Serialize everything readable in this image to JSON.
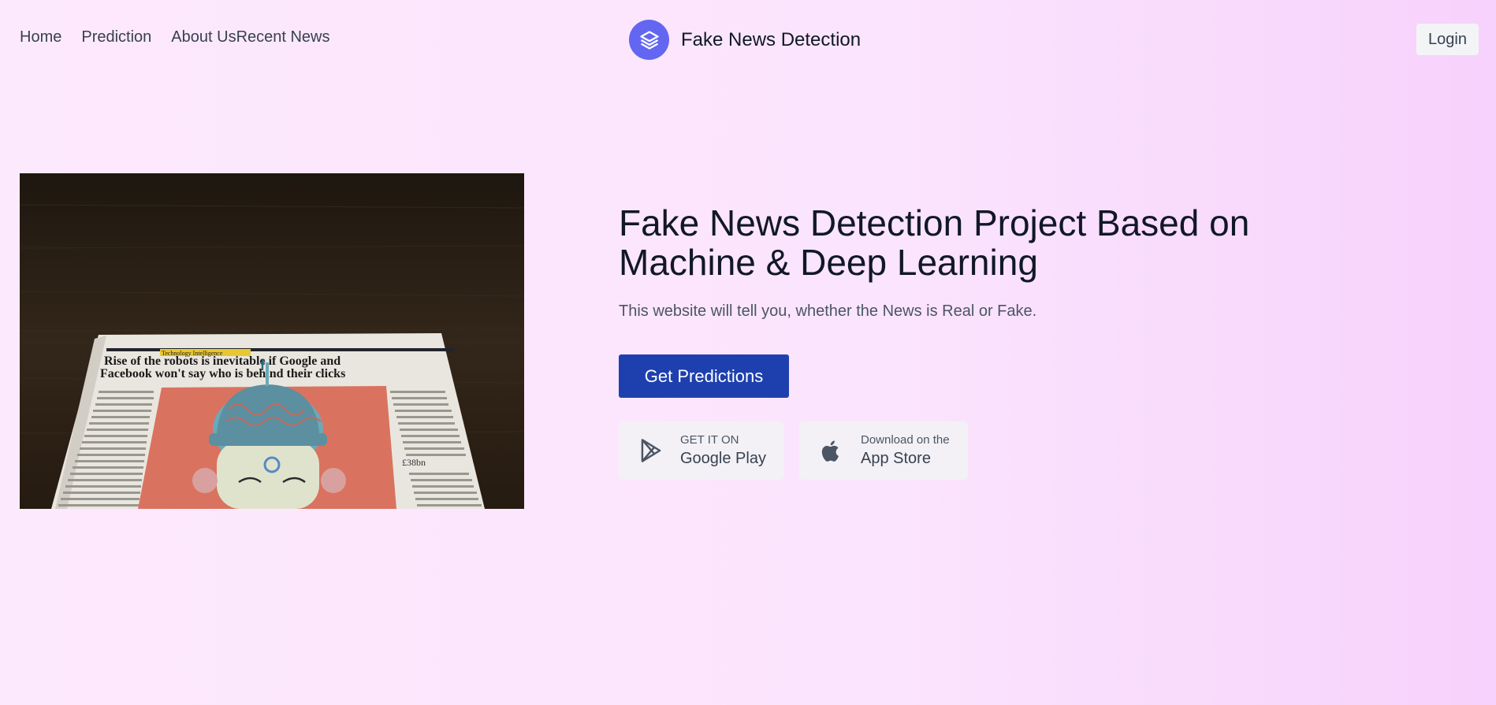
{
  "nav": {
    "home": "Home",
    "prediction": "Prediction",
    "about": "About Us",
    "news": "Recent News"
  },
  "brand": {
    "name": "Fake News Detection",
    "icon": "layers-icon",
    "color": "#6366f1"
  },
  "login_label": "Login",
  "hero": {
    "image_alt": "Newspaper article about robots and Google and Facebook",
    "title": "Fake News Detection Project Based on Machine & Deep Learning",
    "subtitle": "This website will tell you, whether the News is Real or Fake.",
    "cta_label": "Get Predictions",
    "cta_color": "#1e40af"
  },
  "stores": {
    "google": {
      "small": "GET IT ON",
      "big": "Google Play",
      "icon": "google-play-icon"
    },
    "apple": {
      "small": "Download on the",
      "big": "App Store",
      "icon": "apple-icon"
    }
  },
  "newspaper": {
    "section": "Technology Intelligence",
    "headline_1": "Rise of the robots is inevitable if Google and",
    "headline_2": "Facebook won't say who is behind their clicks",
    "price": "£38bn"
  }
}
